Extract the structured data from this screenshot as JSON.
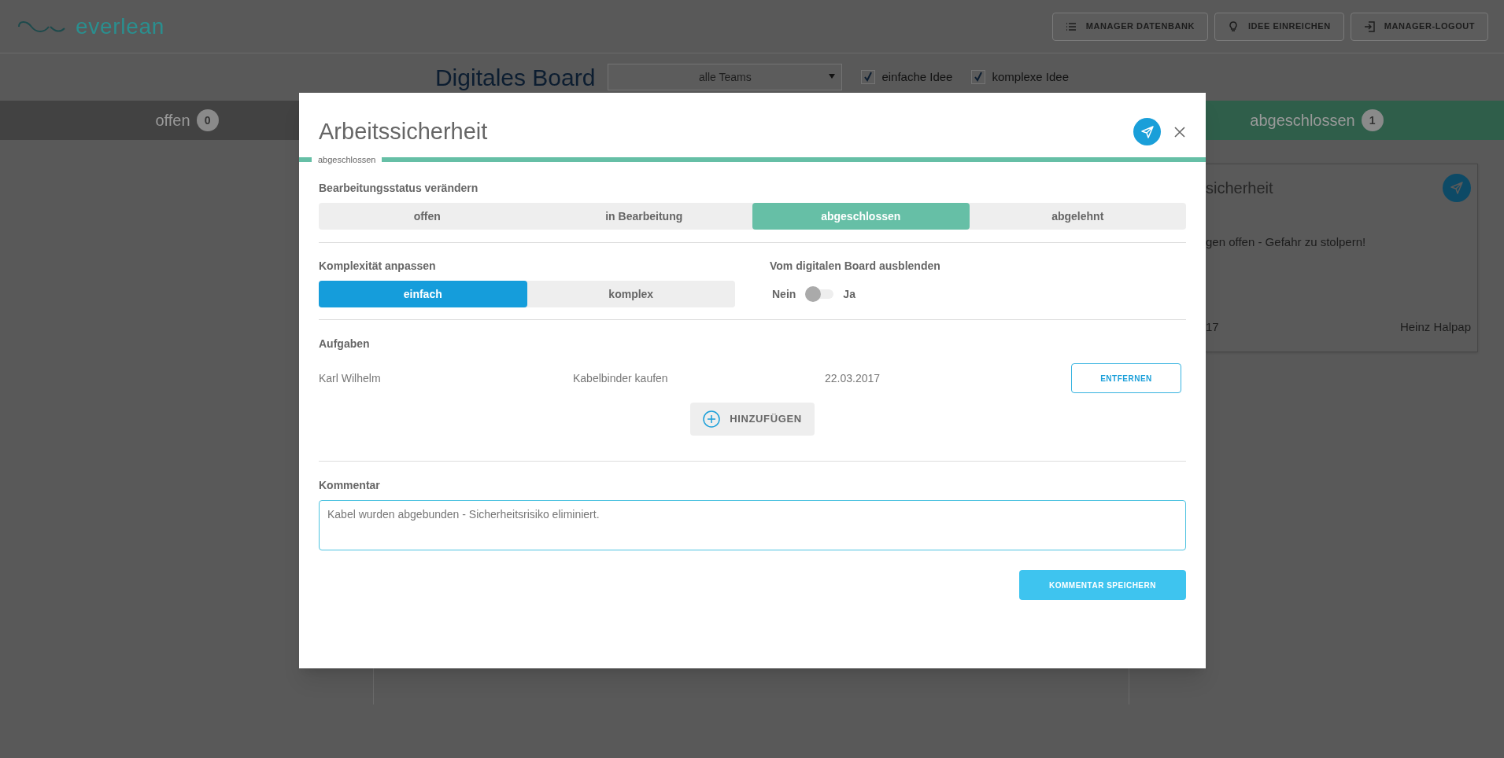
{
  "header": {
    "logo": "everlean",
    "buttons": [
      {
        "label": "MANAGER DATENBANK",
        "kind": "list"
      },
      {
        "label": "IDEE EINREICHEN",
        "kind": "bulb"
      },
      {
        "label": "MANAGER-LOGOUT",
        "kind": "logout"
      }
    ]
  },
  "board": {
    "title": "Digitales Board",
    "team_filter": "alle Teams",
    "filters": [
      {
        "label": "einfache Idee",
        "checked": true
      },
      {
        "label": "komplexe Idee",
        "checked": true
      }
    ]
  },
  "columns": [
    {
      "label": "offen",
      "count": "0",
      "color": "#424242"
    },
    {
      "label": "abgeschlossen",
      "count": "1",
      "color": "#2f5e4a"
    }
  ],
  "card": {
    "title": "sicherheit",
    "description": "gen offen - Gefahr zu stolpern!",
    "date": "17",
    "author": "Heinz Halpap"
  },
  "dialog": {
    "title": "Arbeitssicherheit",
    "status_tag": "abgeschlossen",
    "status": {
      "label": "Bearbeitungsstatus verändern",
      "options": [
        {
          "label": "offen",
          "selected": false
        },
        {
          "label": "in Bearbeitung",
          "selected": false
        },
        {
          "label": "abgeschlossen",
          "selected": true
        },
        {
          "label": "abgelehnt",
          "selected": false
        }
      ]
    },
    "complexity": {
      "label": "Komplexität anpassen",
      "options": [
        {
          "label": "einfach",
          "selected": true
        },
        {
          "label": "komplex",
          "selected": false
        }
      ]
    },
    "hide": {
      "label": "Vom digitalen Board ausblenden",
      "off_label": "Nein",
      "on_label": "Ja",
      "on": false
    },
    "tasks": {
      "label": "Aufgaben",
      "rows": [
        {
          "assignee": "Karl Wilhelm",
          "task": "Kabelbinder kaufen",
          "date": "22.03.2017",
          "action": "ENTFERNEN"
        }
      ],
      "add_button": "HINZUFÜGEN"
    },
    "comment": {
      "label": "Kommentar",
      "value": "Kabel wurden abgebunden - Sicherheitsrisiko eliminiert.",
      "save_button": "KOMMENTAR SPEICHERN"
    }
  }
}
